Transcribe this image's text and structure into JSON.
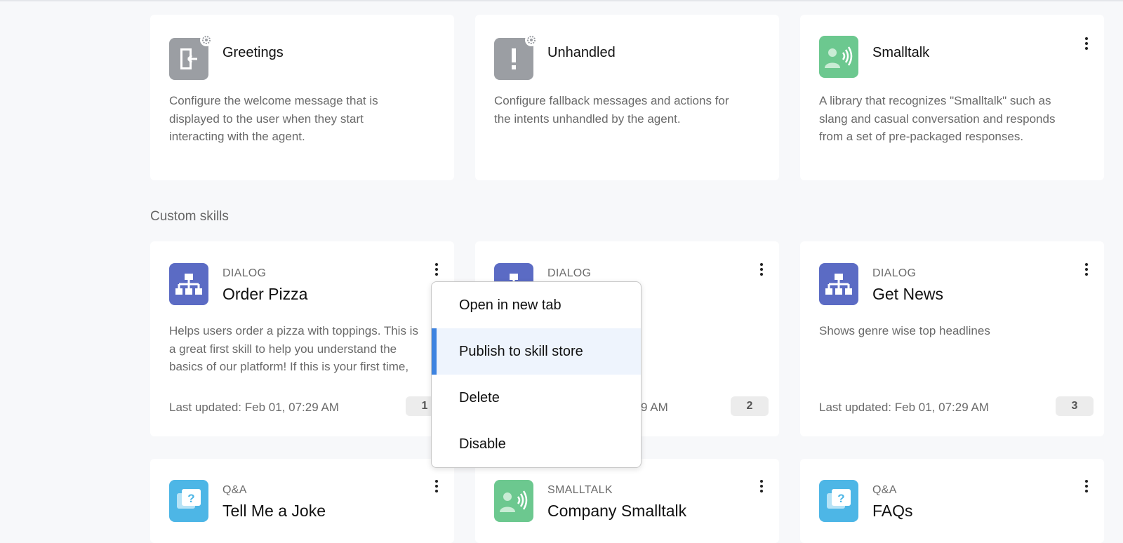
{
  "system_skills": [
    {
      "title": "Greetings",
      "icon": "door-exit-icon",
      "description": [
        "Configure the welcome message that is",
        "displayed to the user when they start",
        "interacting with the agent."
      ]
    },
    {
      "title": "Unhandled",
      "icon": "exclamation-icon",
      "description": [
        "Configure fallback messages and actions for",
        "the intents unhandled by the agent."
      ]
    },
    {
      "title": "Smalltalk",
      "icon": "speaking-person-icon",
      "description": [
        "A library that recognizes \"Smalltalk\" such as",
        "slang and casual conversation and responds",
        "from a set of pre-packaged responses."
      ]
    }
  ],
  "section_title": "Custom skills",
  "custom_skills": [
    {
      "type": "DIALOG",
      "title": "Order Pizza",
      "description": [
        "Helps users order a pizza with toppings. This is",
        "a great first skill to help you understand the",
        "basics of our platform! If this is your first time,"
      ],
      "updated": "Last updated: Feb 01, 07:29 AM",
      "badge": "1"
    },
    {
      "type": "DIALOG",
      "title": "",
      "description": [],
      "updated": "9 AM",
      "badge": "2"
    },
    {
      "type": "DIALOG",
      "title": "Get News",
      "description": [
        "Shows genre wise top headlines"
      ],
      "updated": "Last updated: Feb 01, 07:29 AM",
      "badge": "3"
    },
    {
      "type": "Q&A",
      "title": "Tell Me a Joke"
    },
    {
      "type": "SMALLTALK",
      "title": "Company Smalltalk"
    },
    {
      "type": "Q&A",
      "title": "FAQs"
    }
  ],
  "context_menu": {
    "items": [
      "Open in new tab",
      "Publish to skill store",
      "Delete",
      "Disable"
    ]
  },
  "colors": {
    "accent": "#3d83e0",
    "dialog_icon": "#5b6bc4",
    "qa_icon": "#4db6e6",
    "smalltalk_icon": "#6cc88f",
    "system_icon": "#9b9ea3"
  }
}
